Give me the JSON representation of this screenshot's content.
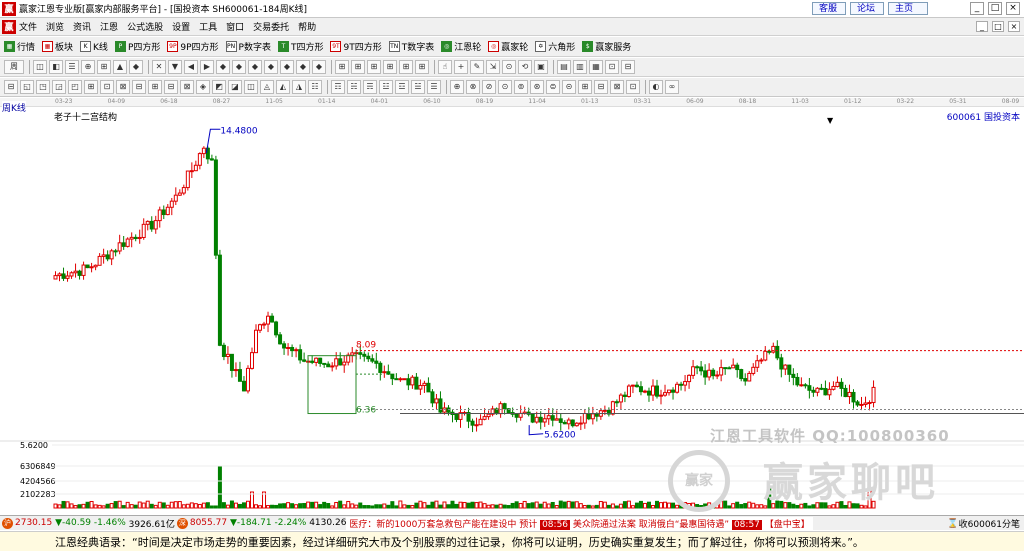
{
  "window": {
    "title": "赢家江恩专业版[赢家内部服务平台] - [国投资本  SH600061-184周K线]",
    "app_icon": "赢",
    "links": [
      "客服",
      "论坛",
      "主页"
    ],
    "controls": [
      "_",
      "□",
      "×"
    ]
  },
  "menu": {
    "items": [
      "文件",
      "浏览",
      "资讯",
      "江恩",
      "公式选股",
      "设置",
      "工具",
      "窗口",
      "交易委托",
      "帮助"
    ]
  },
  "toolbar1": [
    {
      "icon": "grid-icon",
      "glyph": "▦",
      "label": "行情"
    },
    {
      "icon": "blocks-icon",
      "glyph": "▦",
      "label": "板块"
    },
    {
      "icon": "kline-icon",
      "glyph": "K",
      "label": "K线"
    },
    {
      "icon": "p-square-icon",
      "glyph": "P",
      "label": "P四方形"
    },
    {
      "icon": "9p-square-icon",
      "glyph": "9P",
      "label": "9P四方形"
    },
    {
      "icon": "pn-table-icon",
      "glyph": "PN",
      "label": "P数字表"
    },
    {
      "icon": "t-square-icon",
      "glyph": "T",
      "label": "T四方形"
    },
    {
      "icon": "9t-square-icon",
      "glyph": "9T",
      "label": "9T四方形"
    },
    {
      "icon": "tn-table-icon",
      "glyph": "TN",
      "label": "T数字表"
    },
    {
      "icon": "gann-wheel-icon",
      "glyph": "◎",
      "label": "江恩轮"
    },
    {
      "icon": "winner-wheel-icon",
      "glyph": "◎",
      "label": "赢家轮"
    },
    {
      "icon": "hexagon-icon",
      "glyph": "✡",
      "label": "六角形"
    },
    {
      "icon": "service-icon",
      "glyph": "$",
      "label": "赢家服务"
    }
  ],
  "toolbar2_period": "周",
  "datestrip": [
    "03-23",
    "04-09",
    "06-18",
    "08-27",
    "11-05",
    "01-14",
    "04-01",
    "06-10",
    "08-19",
    "11-04",
    "01-13",
    "03-31",
    "06-09",
    "08-18",
    "11-03",
    "01-12",
    "03-22",
    "05-31",
    "08-09"
  ],
  "chart_header": {
    "period": "周K线",
    "indicator": "老子十二宫结构",
    "stock": "600061  国投资本",
    "dropdown": "▼"
  },
  "chart_data": {
    "type": "candlestick",
    "annotations": {
      "high_label": "14.4800",
      "low_label": "5.6200",
      "upper_line_label": "8.09",
      "lower_line_label": "6.36"
    },
    "volume_axis_labels": [
      "5.6200",
      "6306849",
      "4204566",
      "2102283"
    ],
    "ohlc_sample": {
      "start_open": 10.2,
      "peak": 14.48,
      "trough": 5.62,
      "last_close": 6.75
    }
  },
  "watermark": {
    "line1": "江恩工具软件  QQ:100800360",
    "circle": "赢家",
    "big": "赢家聊吧"
  },
  "status": {
    "sh_icon": "沪",
    "sh_index": "2730.15",
    "sh_change": "▼-40.59",
    "sh_pct": "-1.46%",
    "sh_amount": "3926.61亿",
    "sz_icon": "深",
    "sz_index": "8055.77",
    "sz_change": "▼-184.71",
    "sz_pct": "-2.24%",
    "sz_amount": "4130.26",
    "news1": "医疗：新的1000万套急救包产能在建设中 预计",
    "time1": "08:56",
    "news2": "美众院通过法案 取消俄白“最惠国待遇”",
    "time2": "08:57",
    "news3": "【盘中宝】",
    "right_text": "收600061分笔"
  },
  "quote": "江恩经典语录：“时间是决定市场走势的重要因素，经过详细研究大市及个别股票的过往记录，你将可以证明，历史确实重复发生；而了解过往，你将可以预测将来。”。"
}
